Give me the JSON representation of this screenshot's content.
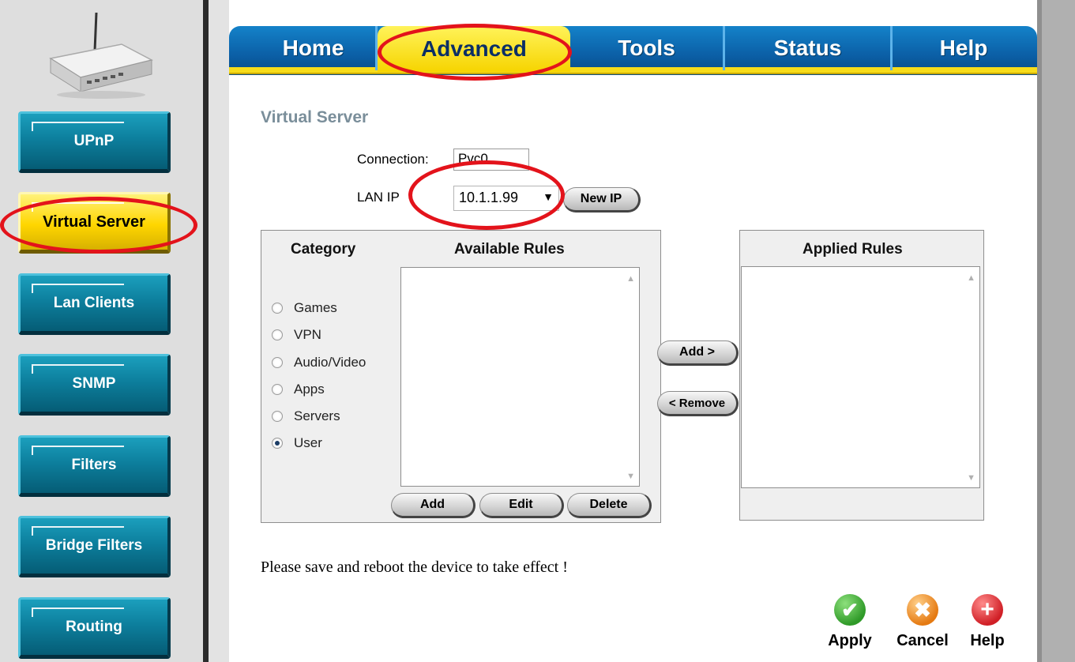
{
  "sidebar": {
    "items": [
      {
        "label": "UPnP",
        "active": false
      },
      {
        "label": "Virtual Server",
        "active": true
      },
      {
        "label": "Lan Clients",
        "active": false
      },
      {
        "label": "SNMP",
        "active": false
      },
      {
        "label": "Filters",
        "active": false
      },
      {
        "label": "Bridge Filters",
        "active": false
      },
      {
        "label": "Routing",
        "active": false
      }
    ]
  },
  "tabs": [
    {
      "label": "Home",
      "active": false
    },
    {
      "label": "Advanced",
      "active": true
    },
    {
      "label": "Tools",
      "active": false
    },
    {
      "label": "Status",
      "active": false
    },
    {
      "label": "Help",
      "active": false
    }
  ],
  "page": {
    "title": "Virtual Server",
    "connection_label": "Connection:",
    "connection_value": "Pvc0",
    "lan_ip_label": "LAN IP",
    "lan_ip_value": "10.1.1.99",
    "new_ip_button": "New IP"
  },
  "rules": {
    "category_header": "Category",
    "available_header": "Available Rules",
    "applied_header": "Applied Rules",
    "categories": [
      {
        "label": "Games",
        "checked": false
      },
      {
        "label": "VPN",
        "checked": false
      },
      {
        "label": "Audio/Video",
        "checked": false
      },
      {
        "label": "Apps",
        "checked": false
      },
      {
        "label": "Servers",
        "checked": false
      },
      {
        "label": "User",
        "checked": true
      }
    ],
    "add_button": "Add",
    "edit_button": "Edit",
    "delete_button": "Delete",
    "add_rule_button": "Add >",
    "remove_rule_button": "< Remove"
  },
  "footer": {
    "note": "Please save and reboot the device to take effect !",
    "apply": "Apply",
    "cancel": "Cancel",
    "help": "Help"
  },
  "colors": {
    "highlight_ring": "#e3131b",
    "tab_blue": "#0b5fa6",
    "tab_active_yellow": "#f6d400",
    "sidebar_teal": "#0d7f9d",
    "apply_green": "#3aa832",
    "cancel_orange": "#f08a1e",
    "help_red": "#d91f26"
  }
}
